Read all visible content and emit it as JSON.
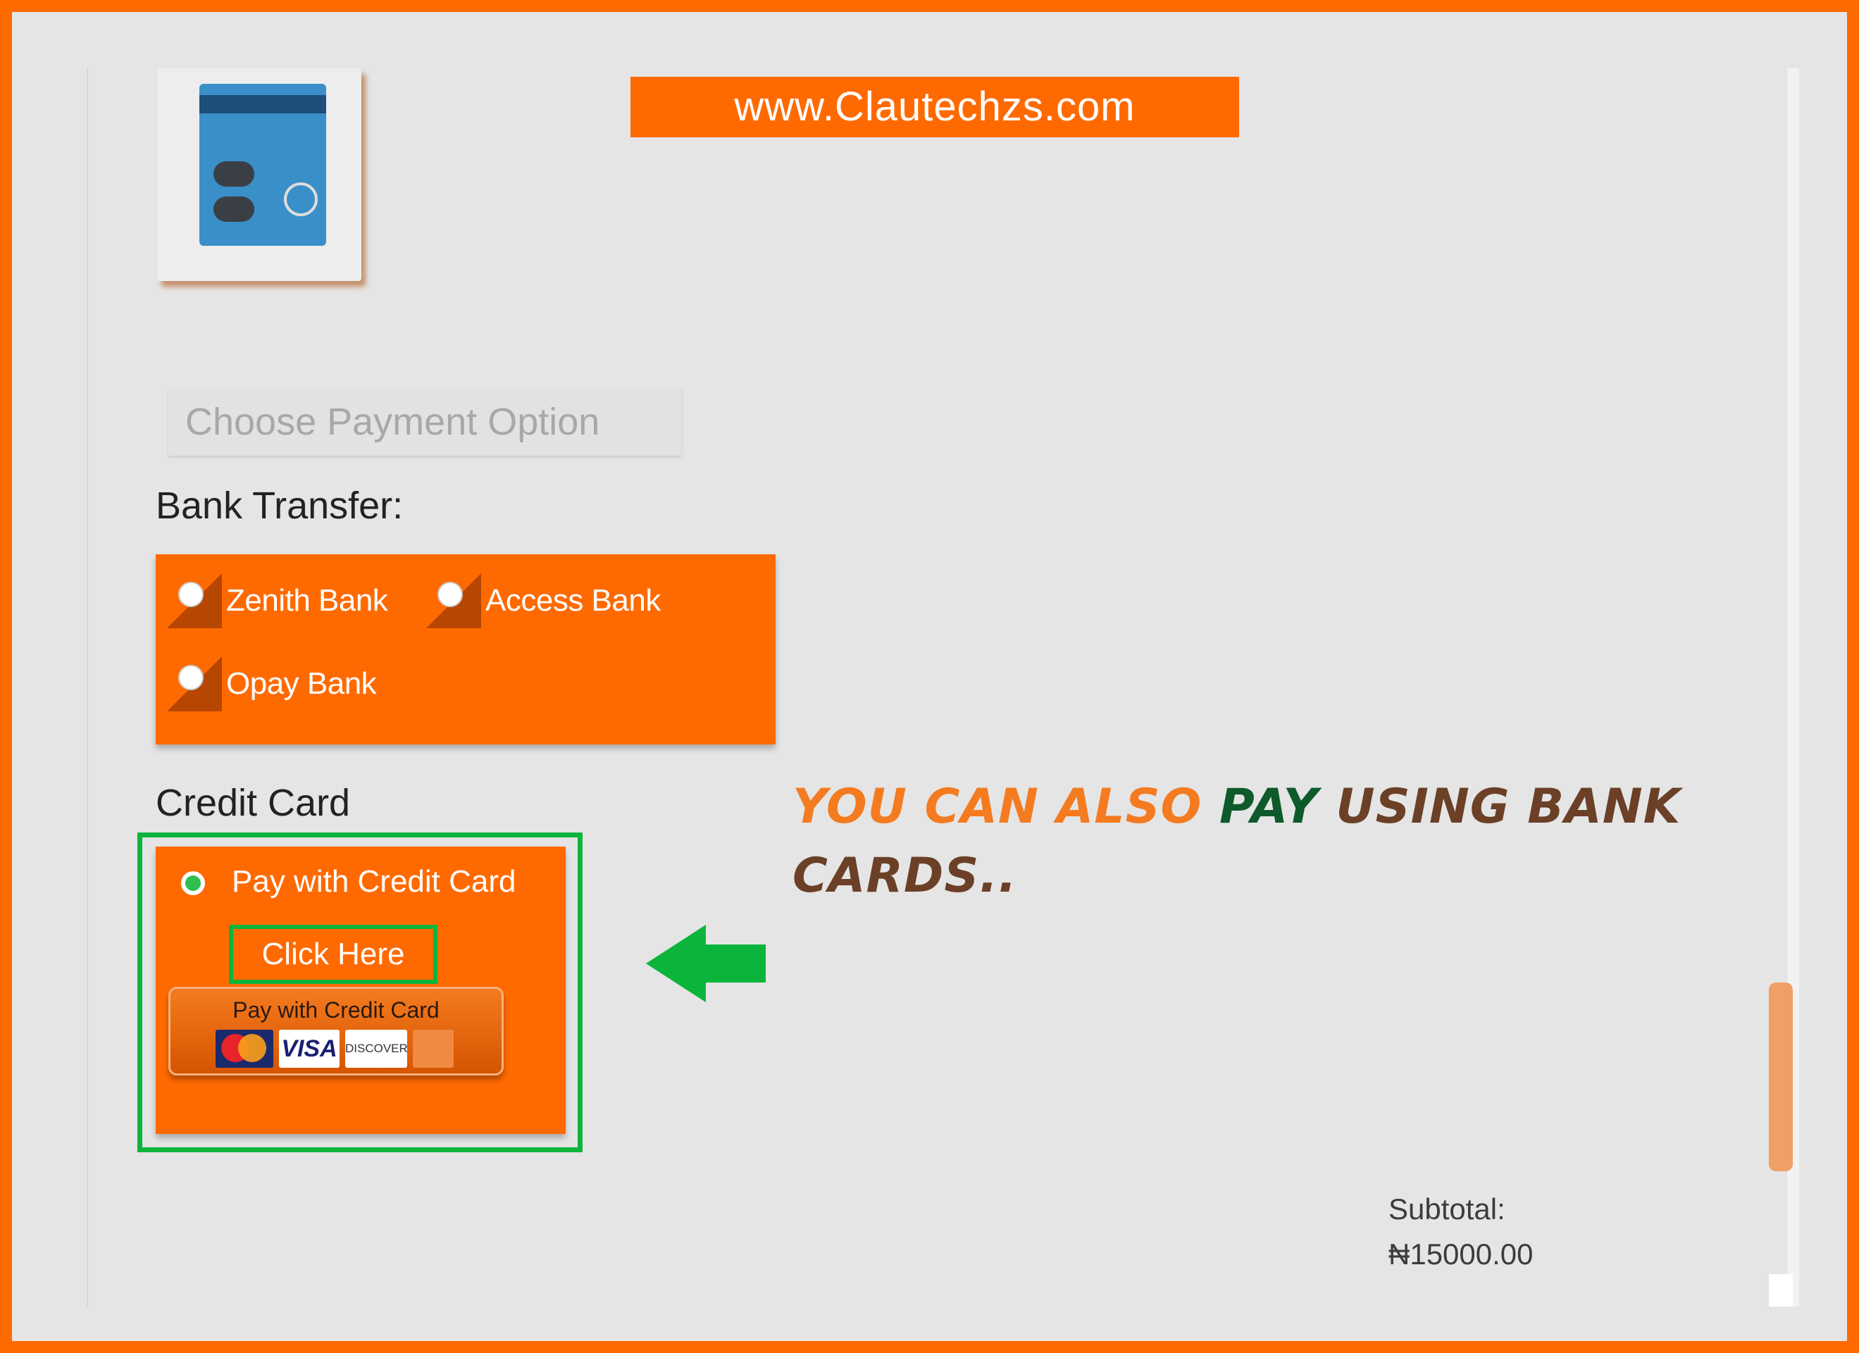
{
  "watermark": {
    "text": "www.Clautechzs.com"
  },
  "payment": {
    "option_placeholder": "Choose Payment Option",
    "bank_transfer_label": "Bank Transfer:",
    "banks": [
      {
        "label": "Zenith Bank"
      },
      {
        "label": "Access Bank"
      },
      {
        "label": "Opay Bank"
      }
    ],
    "credit_card_label": "Credit Card",
    "credit_radio_label": "Pay with Credit Card",
    "click_here": "Click Here",
    "card_button_label": "Pay with Credit Card",
    "card_logos": {
      "mastercard": "mastercard-icon",
      "visa": "VISA",
      "discover": "DISCOVER",
      "amex": "amex-icon"
    }
  },
  "promo": {
    "part1": "YOU CAN ALSO ",
    "part2": "PAY",
    "part3": " USING BANK CARDS.."
  },
  "summary": {
    "subtotal_label": "Subtotal:",
    "subtotal_value": "₦15000.00"
  },
  "colors": {
    "brand_orange": "#ff6a00",
    "highlight_green": "#0bb53b",
    "promo_orange": "#f47b20",
    "promo_green": "#0e5a2b",
    "promo_brown": "#6b4026"
  }
}
